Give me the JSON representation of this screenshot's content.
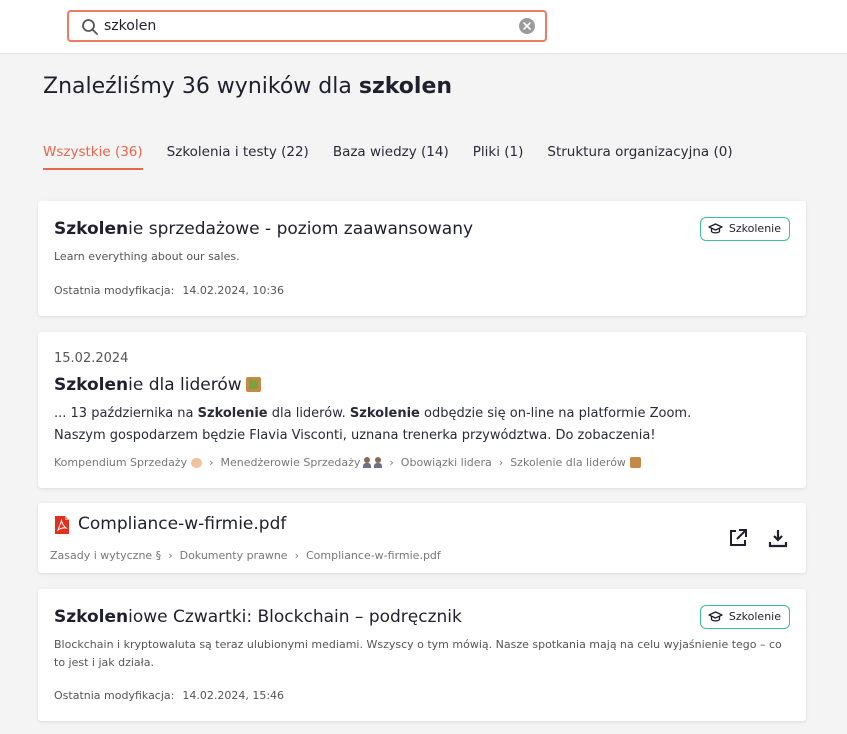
{
  "search": {
    "value": "szkolen"
  },
  "heading": {
    "prefix": "Znaleźliśmy 36 wyników dla ",
    "query": "szkolen"
  },
  "tabs": [
    {
      "label": "Wszystkie (36)"
    },
    {
      "label": "Szkolenia i testy (22)"
    },
    {
      "label": "Baza wiedzy (14)"
    },
    {
      "label": "Pliki (1)"
    },
    {
      "label": "Struktura organizacyjna (0)"
    }
  ],
  "card1": {
    "title_match": "Szkolen",
    "title_rest": "ie sprzedażowe - poziom zaawansowany",
    "badge": "Szkolenie",
    "description": "Learn everything about our sales.",
    "modified_label": "Ostatnia modyfikacja:",
    "modified_value": "14.02.2024, 10:36"
  },
  "card2": {
    "date": "15.02.2024",
    "title_match": "Szkolen",
    "title_rest": "ie dla liderów",
    "excerpt_1": "... 13 października na ",
    "excerpt_b1": "Szkolenie",
    "excerpt_2": " dla liderów. ",
    "excerpt_b2": "Szkolenie",
    "excerpt_3": " odbędzie się on-line na platformie Zoom. Naszym gospodarzem będzie Flavia Visconti, uznana trenerka przywództwa. Do zobaczenia!",
    "crumbs": [
      "Kompendium Sprzedaży",
      "Menedżerowie Sprzedaży",
      "Obowiązki lidera",
      "Szkolenie dla liderów"
    ]
  },
  "card3": {
    "file_name": "Compliance-w-firmie.pdf",
    "crumbs": [
      "Zasady i wytyczne §",
      "Dokumenty prawne",
      "Compliance-w-firmie.pdf"
    ]
  },
  "card4": {
    "title_match": "Szkolen",
    "title_rest": "iowe Czwartki: Blockchain – podręcznik",
    "badge": "Szkolenie",
    "description": "Blockchain i kryptowaluta są teraz ulubionymi mediami. Wszyscy o tym mówią. Nasze spotkania mają na celu wyjaśnienie tego – co to jest i jak działa.",
    "modified_label": "Ostatnia modyfikacja:",
    "modified_value": "14.02.2024, 15:46"
  },
  "colors": {
    "accent": "#e8664b",
    "badge_border": "#3dbf8f",
    "pdf_red": "#e0301e"
  }
}
